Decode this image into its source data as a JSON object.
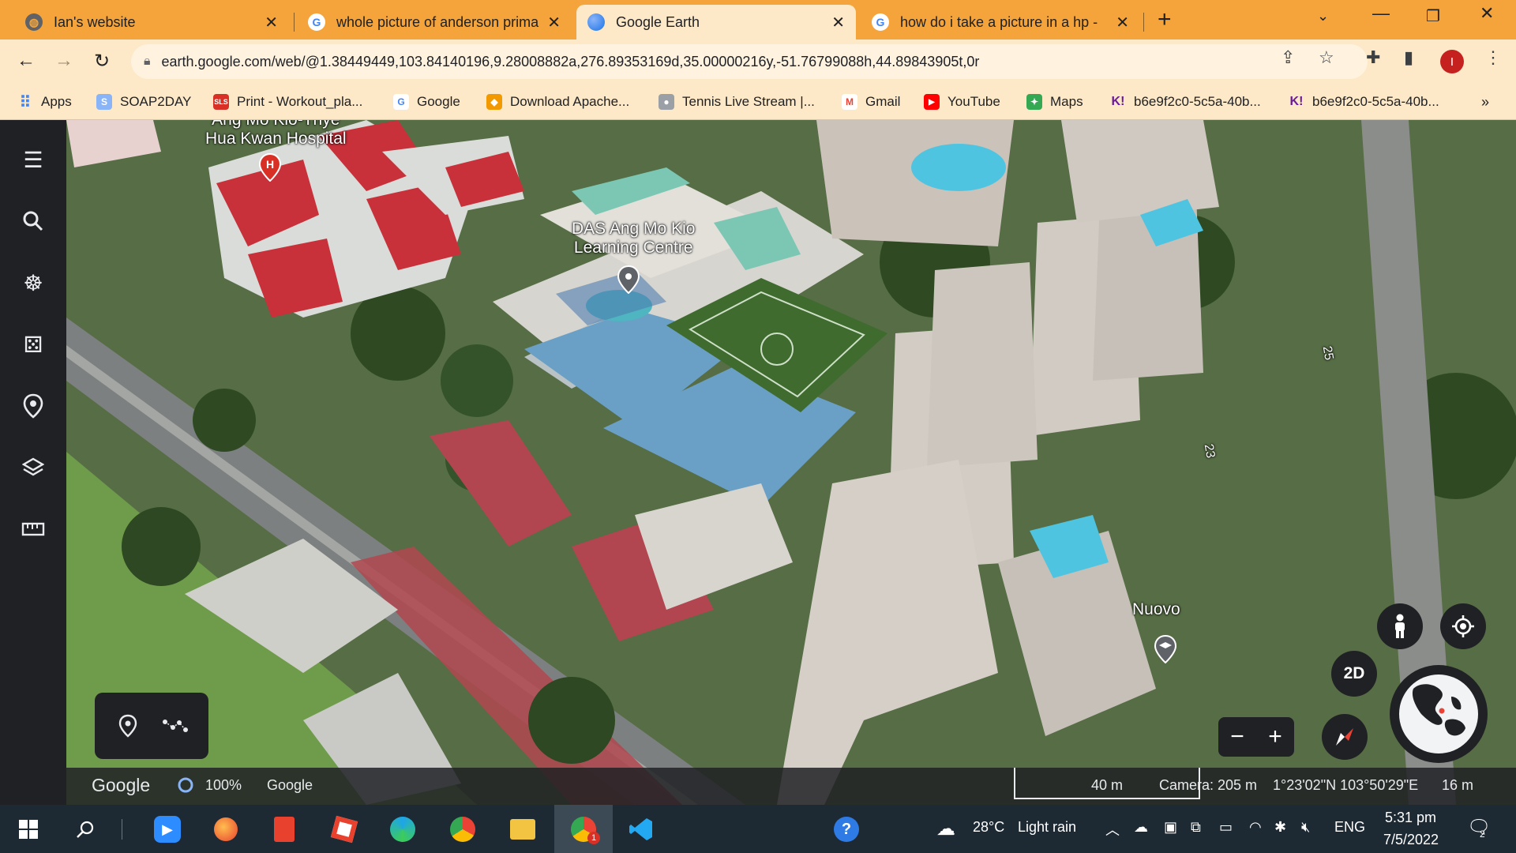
{
  "tabs": [
    {
      "title": "Ian's website",
      "close": "✕"
    },
    {
      "title": "whole picture of anderson prima",
      "close": "✕"
    },
    {
      "title": "Google Earth",
      "close": "✕"
    },
    {
      "title": "how do i take a picture in a hp -",
      "close": "✕"
    }
  ],
  "toolbar": {
    "url": "earth.google.com/web/@1.38449449,103.84140196,9.28008882a,276.89353169d,35.00000216y,-51.76799088h,44.89843905t,0r",
    "profile_initial": "I"
  },
  "bookmarks": [
    {
      "label": "Apps",
      "color": "#4285f4",
      "icon": "apps-grid-icon"
    },
    {
      "label": "SOAP2DAY",
      "color": "#8ab4f8",
      "icon": "soap2day-icon"
    },
    {
      "label": "Print - Workout_pla...",
      "color": "#d93025",
      "icon": "sls-icon"
    },
    {
      "label": "Google",
      "color": "#4285f4",
      "icon": "google-icon"
    },
    {
      "label": "Download Apache...",
      "color": "#f29900",
      "icon": "apache-icon"
    },
    {
      "label": "Tennis Live Stream |...",
      "color": "#9aa0a6",
      "icon": "tennis-icon"
    },
    {
      "label": "Gmail",
      "color": "#ea4335",
      "icon": "gmail-icon"
    },
    {
      "label": "YouTube",
      "color": "#ff0000",
      "icon": "youtube-icon"
    },
    {
      "label": "Maps",
      "color": "#34a853",
      "icon": "maps-icon"
    },
    {
      "label": "b6e9f2c0-5c5a-40b...",
      "color": "#6a1b9a",
      "icon": "kahoot-icon"
    },
    {
      "label": "b6e9f2c0-5c5a-40b...",
      "color": "#6a1b9a",
      "icon": "kahoot-icon"
    }
  ],
  "map": {
    "labels": {
      "hospital": "Ang Mo Kio-Thye\nHua Kwan Hospital",
      "das": "DAS Ang Mo Kio\nLearning Centre",
      "nuovo": "Nuovo",
      "block25": "25",
      "block23": "23"
    },
    "view_mode": "2D"
  },
  "statusbar": {
    "brand": "Google",
    "loading_percent": "100%",
    "attribution": "Google",
    "scale": "40 m",
    "camera": "Camera: 205 m",
    "coordinates": "1°23'02\"N 103°50'29\"E",
    "altitude": "16 m"
  },
  "taskbar": {
    "weather_temp": "28°C",
    "weather_desc": "Light rain",
    "language": "ENG",
    "time": "5:31 pm",
    "date": "7/5/2022",
    "notification_count": "2",
    "chrome_badge": "1"
  }
}
